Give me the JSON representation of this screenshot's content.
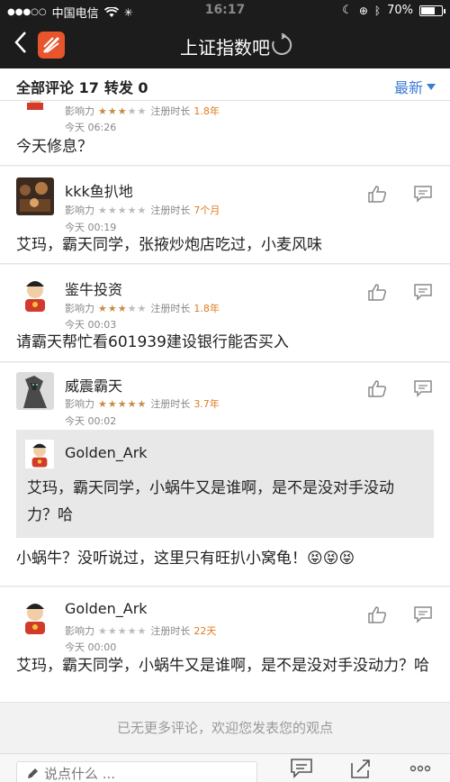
{
  "status": {
    "carrier": "中国电信",
    "time": "16:17",
    "battery": "70%",
    "battery_level": 0.7
  },
  "nav": {
    "title": "上证指数吧"
  },
  "counts": {
    "comments_label": "全部评论 17",
    "forwards_label": "转发 0",
    "sort_label": "最新"
  },
  "comments": [
    {
      "meta_label": "影响力",
      "stars": 3,
      "reg_label": "注册时长",
      "reg_value": "1.8年",
      "time": "今天 06:26",
      "text": "今天修息？"
    },
    {
      "username": "kkk鱼扒地",
      "meta_label": "影响力",
      "stars": 0,
      "reg_label": "注册时长",
      "reg_value": "7个月",
      "time": "今天 00:19",
      "text": "艾玛，霸天同学，张掖炒炮店吃过，小麦风味"
    },
    {
      "username": "鉴牛投资",
      "meta_label": "影响力",
      "stars": 3,
      "reg_label": "注册时长",
      "reg_value": "1.8年",
      "time": "今天 00:03",
      "text": "请霸天帮忙看601939建设银行能否买入"
    },
    {
      "username": "威震霸天",
      "meta_label": "影响力",
      "stars": 5,
      "reg_label": "注册时长",
      "reg_value": "3.7年",
      "time": "今天 00:02",
      "quote_username": "Golden_Ark",
      "quote_text": "艾玛，霸天同学，小蜗牛又是谁啊，是不是没对手没动力？哈",
      "text": "小蜗牛？没听说过，这里只有旺扒小窝龟！😝😝😝"
    },
    {
      "username": "Golden_Ark",
      "meta_label": "影响力",
      "stars": 0,
      "reg_label": "注册时长",
      "reg_value": "22天",
      "time": "今天 00:00",
      "text": "艾玛，霸天同学，小蜗牛又是谁啊，是不是没对手没动力？哈"
    }
  ],
  "footer": {
    "no_more": "已无更多评论，欢迎您发表您的观点"
  },
  "bottom": {
    "input_placeholder": "说点什么 ..."
  },
  "colors": {
    "accent": "#3a7bd5",
    "star": "#c68c45",
    "reg_age": "#e07a1f",
    "nav_bg": "#1c1c1c",
    "logo": "#e8542b"
  }
}
